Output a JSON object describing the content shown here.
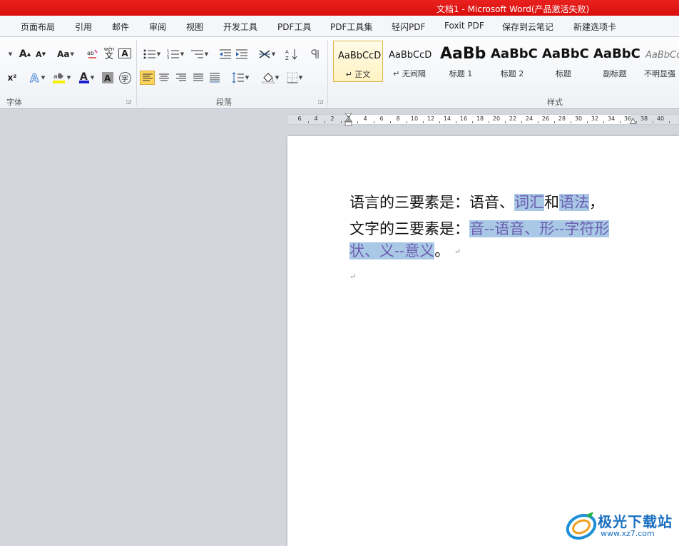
{
  "window": {
    "title": "文档1 - Microsoft Word(产品激活失败)"
  },
  "tabs": [
    "页面布局",
    "引用",
    "邮件",
    "审阅",
    "视图",
    "开发工具",
    "PDF工具",
    "PDF工具集",
    "轻闪PDF",
    "Foxit PDF",
    "保存到云笔记",
    "新建选项卡"
  ],
  "ribbon": {
    "font_group_label": "字体",
    "paragraph_group_label": "段落",
    "styles_group_label": "样式",
    "aa_label": "Aa",
    "pinyin_label": "wén",
    "pinyin_char": "文",
    "boxed_a": "A",
    "enclosed_char": "字",
    "superscript_label": "x²",
    "grow_font": "A",
    "shrink_font": "A"
  },
  "styles": [
    {
      "sample": "AaBbCcD",
      "name": "↵ 正文",
      "active": true
    },
    {
      "sample": "AaBbCcD",
      "name": "↵ 无间隔"
    },
    {
      "sample": "AaBb",
      "name": "标题 1"
    },
    {
      "sample": "AaBbC",
      "name": "标题 2"
    },
    {
      "sample": "AaBbC",
      "name": "标题"
    },
    {
      "sample": "AaBbC",
      "name": "副标题"
    },
    {
      "sample": "AaBbCc",
      "name": "不明显强"
    }
  ],
  "ruler": {
    "numbers": [
      "6",
      "4",
      "2",
      "2",
      "4",
      "6",
      "8",
      "10",
      "12",
      "14",
      "16",
      "18",
      "20",
      "22",
      "24",
      "26",
      "28",
      "30",
      "32",
      "34",
      "36",
      "38",
      "40"
    ]
  },
  "document": {
    "line1": {
      "prefix": "语言的三要素是：语音、",
      "hl1": "词汇",
      "mid": "和",
      "hl2": "语法",
      "suffix": "，"
    },
    "line2": {
      "prefix": "文字的三要素是：",
      "hl": "音--语音、形--字符形"
    },
    "line3": {
      "hl": "状、义--意义",
      "suffix": "。"
    },
    "para_mark": "↵"
  },
  "watermark": {
    "text": "极光下载站",
    "url": "www.xz7.com",
    "brand_color": "#1a6fc0"
  }
}
